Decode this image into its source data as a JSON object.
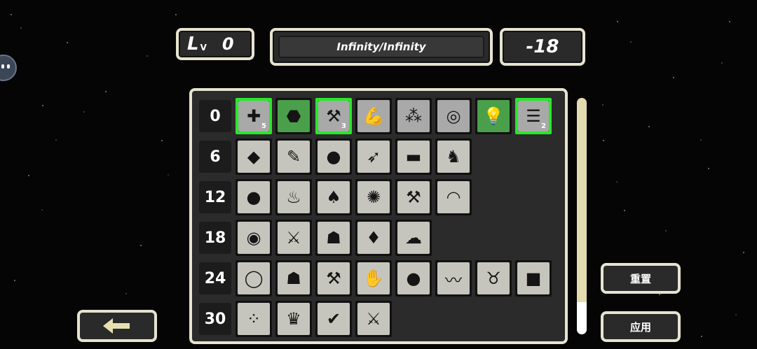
{
  "hud": {
    "level_prefix": "L",
    "level_sub": "V",
    "level_value": "0",
    "progress": "Infinity/Infinity",
    "points": "-18"
  },
  "rows": [
    {
      "label": "0",
      "cells": [
        {
          "icon": "plus-icon",
          "glyph": "✚",
          "style": "grey",
          "selected": true,
          "count": "5"
        },
        {
          "icon": "turtle-shell-icon",
          "glyph": "⬣",
          "style": "green",
          "selected": false,
          "count": ""
        },
        {
          "icon": "tools-icon",
          "glyph": "⚒",
          "style": "grey",
          "selected": true,
          "count": "3"
        },
        {
          "icon": "muscle-arm-icon",
          "glyph": "💪",
          "style": "grey",
          "selected": false,
          "count": ""
        },
        {
          "icon": "coins-icon",
          "glyph": "⁂",
          "style": "grey",
          "selected": false,
          "count": ""
        },
        {
          "icon": "magnet-icon",
          "glyph": "◎",
          "style": "grey",
          "selected": false,
          "count": ""
        },
        {
          "icon": "lightbulb-icon",
          "glyph": "💡",
          "style": "green",
          "selected": false,
          "count": ""
        },
        {
          "icon": "coin-stack-icon",
          "glyph": "☰",
          "style": "grey",
          "selected": true,
          "count": "2"
        }
      ]
    },
    {
      "label": "6",
      "cells": [
        {
          "icon": "locked-skill-icon",
          "glyph": "◆",
          "style": "",
          "selected": false,
          "count": ""
        },
        {
          "icon": "feather-icon",
          "glyph": "✎",
          "style": "",
          "selected": false,
          "count": ""
        },
        {
          "icon": "bird-icon",
          "glyph": "●",
          "style": "",
          "selected": false,
          "count": ""
        },
        {
          "icon": "arrows-icon",
          "glyph": "➶",
          "style": "",
          "selected": false,
          "count": ""
        },
        {
          "icon": "scroll-icon",
          "glyph": "▬",
          "style": "",
          "selected": false,
          "count": ""
        },
        {
          "icon": "rabbit-icon",
          "glyph": "♞",
          "style": "",
          "selected": false,
          "count": ""
        }
      ]
    },
    {
      "label": "12",
      "cells": [
        {
          "icon": "orb-icon",
          "glyph": "●",
          "style": "",
          "selected": false,
          "count": ""
        },
        {
          "icon": "pot-icon",
          "glyph": "♨",
          "style": "",
          "selected": false,
          "count": ""
        },
        {
          "icon": "fire-icon",
          "glyph": "♠",
          "style": "",
          "selected": false,
          "count": ""
        },
        {
          "icon": "swirl-icon",
          "glyph": "✺",
          "style": "",
          "selected": false,
          "count": ""
        },
        {
          "icon": "axe-icon",
          "glyph": "⚒",
          "style": "",
          "selected": false,
          "count": ""
        },
        {
          "icon": "rainbow-icon",
          "glyph": "◠",
          "style": "",
          "selected": false,
          "count": ""
        }
      ]
    },
    {
      "label": "18",
      "cells": [
        {
          "icon": "stones-icon",
          "glyph": "◉",
          "style": "",
          "selected": false,
          "count": ""
        },
        {
          "icon": "swords-icon",
          "glyph": "⚔",
          "style": "",
          "selected": false,
          "count": ""
        },
        {
          "icon": "helmet-icon",
          "glyph": "☗",
          "style": "",
          "selected": false,
          "count": ""
        },
        {
          "icon": "crystal-icon",
          "glyph": "♦",
          "style": "",
          "selected": false,
          "count": ""
        },
        {
          "icon": "rocks-icon",
          "glyph": "☁",
          "style": "",
          "selected": false,
          "count": ""
        }
      ]
    },
    {
      "label": "24",
      "cells": [
        {
          "icon": "bag-icon",
          "glyph": "◯",
          "style": "",
          "selected": false,
          "count": ""
        },
        {
          "icon": "house-icon",
          "glyph": "☗",
          "style": "",
          "selected": false,
          "count": ""
        },
        {
          "icon": "hammer-icon",
          "glyph": "⚒",
          "style": "",
          "selected": false,
          "count": ""
        },
        {
          "icon": "claw-icon",
          "glyph": "✋",
          "style": "",
          "selected": false,
          "count": ""
        },
        {
          "icon": "blob-icon",
          "glyph": "●",
          "style": "",
          "selected": false,
          "count": ""
        },
        {
          "icon": "mustache-icon",
          "glyph": "〰",
          "style": "",
          "selected": false,
          "count": ""
        },
        {
          "icon": "demon-icon",
          "glyph": "♉",
          "style": "",
          "selected": false,
          "count": ""
        },
        {
          "icon": "square-icon",
          "glyph": "■",
          "style": "",
          "selected": false,
          "count": ""
        }
      ]
    },
    {
      "label": "30",
      "cells": [
        {
          "icon": "beans-icon",
          "glyph": "⁘",
          "style": "",
          "selected": false,
          "count": ""
        },
        {
          "icon": "crown-icon",
          "glyph": "♛",
          "style": "",
          "selected": false,
          "count": ""
        },
        {
          "icon": "checkmark-icon",
          "glyph": "✔",
          "style": "",
          "selected": false,
          "count": ""
        },
        {
          "icon": "dragon-sword-icon",
          "glyph": "⚔",
          "style": "",
          "selected": false,
          "count": ""
        }
      ]
    }
  ],
  "buttons": {
    "reset": "重置",
    "apply": "应用",
    "back_icon": "left-arrow-icon"
  },
  "colors": {
    "frame": "#e6e3cf",
    "selected_border": "#29e82a",
    "active_cell": "#4aa04a"
  }
}
